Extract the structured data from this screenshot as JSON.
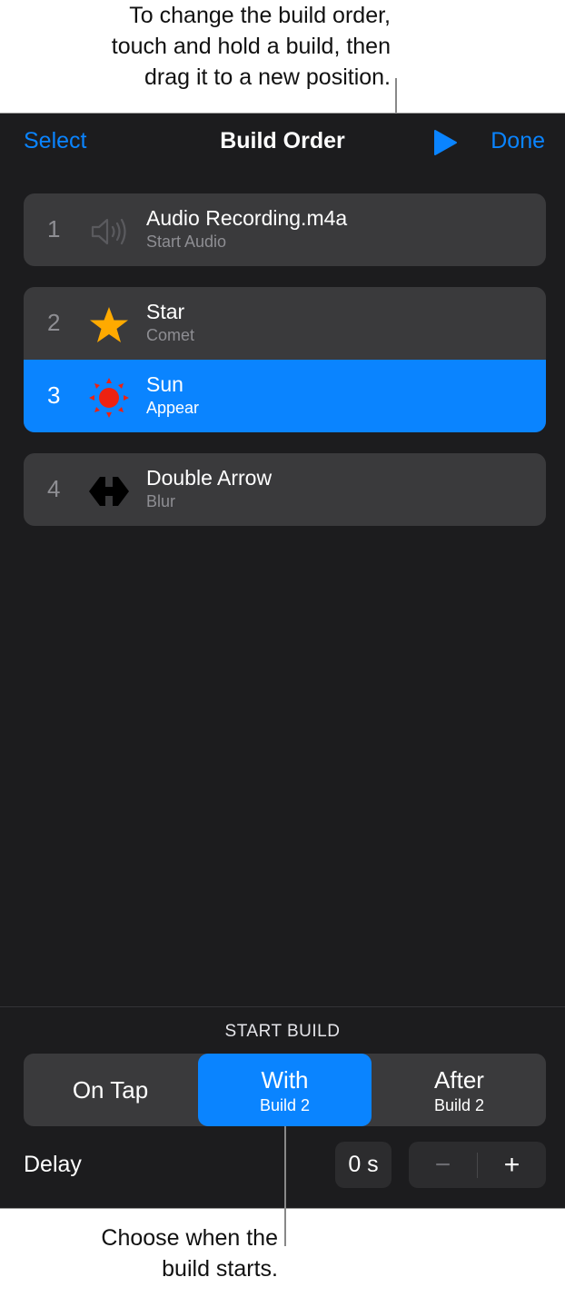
{
  "callouts": {
    "top": [
      "To change the build order,",
      "touch and hold a build, then",
      "drag it to a new position."
    ],
    "bottom": [
      "Choose when the",
      "build starts."
    ]
  },
  "navbar": {
    "select_label": "Select",
    "title": "Build Order",
    "play_icon": "play-icon",
    "done_label": "Done",
    "accent_color": "#0a84ff"
  },
  "builds": [
    {
      "number": "1",
      "title": "Audio Recording.m4a",
      "subtitle": "Start Audio",
      "icon": "speaker-icon",
      "selected": false
    },
    {
      "number": "2",
      "title": "Star",
      "subtitle": "Comet",
      "icon": "star-icon",
      "selected": false
    },
    {
      "number": "3",
      "title": "Sun",
      "subtitle": "Appear",
      "icon": "sun-icon",
      "selected": true
    },
    {
      "number": "4",
      "title": "Double Arrow",
      "subtitle": "Blur",
      "icon": "double-arrow-icon",
      "selected": false
    }
  ],
  "start_build": {
    "section_label": "START BUILD",
    "options": [
      {
        "label": "On Tap",
        "sub": "",
        "selected": false
      },
      {
        "label": "With",
        "sub": "Build 2",
        "selected": true
      },
      {
        "label": "After",
        "sub": "Build 2",
        "selected": false
      }
    ]
  },
  "delay": {
    "label": "Delay",
    "value": "0 s",
    "minus_label": "−",
    "plus_label": "+"
  }
}
